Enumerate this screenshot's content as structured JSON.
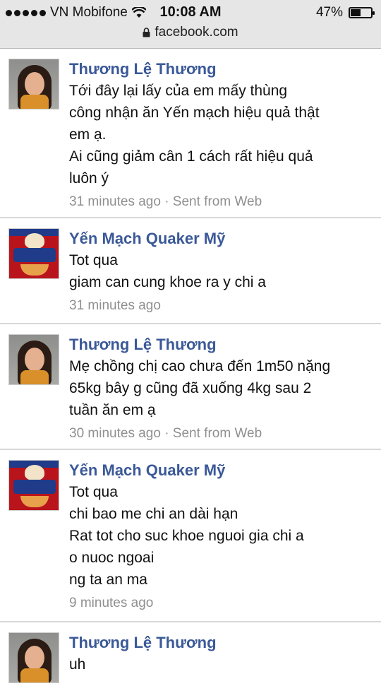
{
  "status_bar": {
    "carrier": "VN Mobifone",
    "time": "10:08 AM",
    "battery_percent": "47%",
    "battery_level": 0.47,
    "icons": [
      "signal-icon",
      "wifi-icon",
      "battery-icon"
    ]
  },
  "url_bar": {
    "domain": "facebook.com",
    "icon": "lock-icon"
  },
  "comments": [
    {
      "author": "Thương Lệ Thương",
      "avatar": "woman-avatar",
      "lines": [
        "Tới đây lại lấy của em mấy thùng",
        "công nhận ăn Yến mạch hiệu quả thật",
        "em ạ.",
        "Ai cũng giảm cân 1 cách rất hiệu quả",
        "luôn ý"
      ],
      "meta": "31 minutes ago · Sent from Web"
    },
    {
      "author": "Yến Mạch Quaker Mỹ",
      "avatar": "quaker-oats-avatar",
      "lines": [
        "Tot qua",
        "giam can cung khoe ra y chi a"
      ],
      "meta": "31 minutes ago"
    },
    {
      "author": "Thương Lệ Thương",
      "avatar": "woman-avatar",
      "lines": [
        "Mẹ chồng chị cao chưa đến 1m50 nặng",
        "65kg bây g cũng đã xuống 4kg sau 2",
        "tuần ăn em ạ"
      ],
      "meta": "30 minutes ago · Sent from Web"
    },
    {
      "author": "Yến Mạch Quaker Mỹ",
      "avatar": "quaker-oats-avatar",
      "lines": [
        "Tot qua",
        "chi bao me chi an dài hạn",
        "Rat tot cho suc khoe nguoi gia chi a",
        "o nuoc ngoai",
        "ng ta an ma"
      ],
      "meta": "9 minutes ago"
    },
    {
      "author": "Thương Lệ Thương",
      "avatar": "woman-avatar",
      "lines": [
        "uh"
      ],
      "meta": ""
    }
  ]
}
